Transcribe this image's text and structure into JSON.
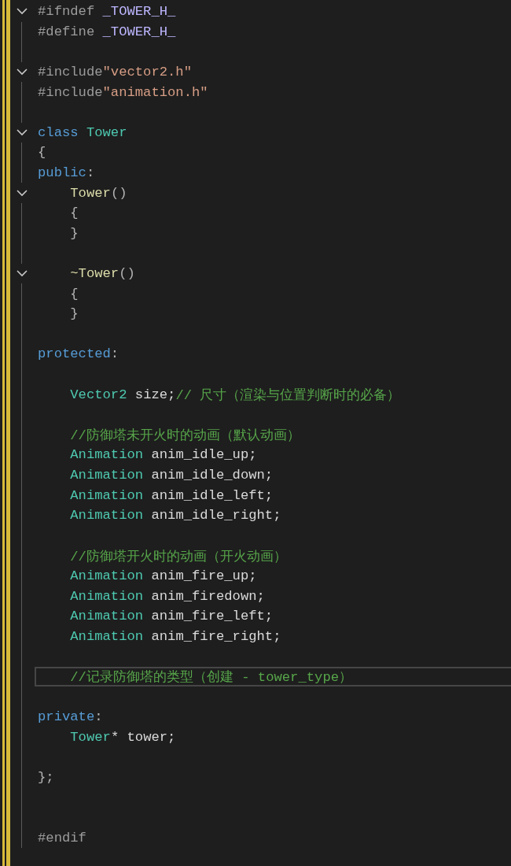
{
  "editor": {
    "lines": [
      {
        "foldable": true,
        "current": false,
        "indented": false,
        "tokens": [
          {
            "kind": "pre",
            "text": "#ifndef"
          },
          {
            "kind": "macro",
            "text": " _TOWER_H_"
          }
        ]
      },
      {
        "foldable": false,
        "current": false,
        "indented": false,
        "tokens": [
          {
            "kind": "pre",
            "text": "#define"
          },
          {
            "kind": "macro",
            "text": " _TOWER_H_"
          }
        ]
      },
      {
        "foldable": false,
        "current": false,
        "indented": false
      },
      {
        "foldable": true,
        "current": false,
        "indented": false,
        "tokens": [
          {
            "kind": "pre",
            "text": "#include"
          },
          {
            "kind": "string",
            "text": "\"vector2.h\""
          }
        ]
      },
      {
        "foldable": false,
        "current": false,
        "indented": false,
        "tokens": [
          {
            "kind": "pre",
            "text": "#include"
          },
          {
            "kind": "string",
            "text": "\"animation.h\""
          }
        ]
      },
      {
        "foldable": false,
        "current": false,
        "indented": false
      },
      {
        "foldable": true,
        "current": false,
        "indented": false,
        "tokens": [
          {
            "kind": "keyword",
            "text": "class"
          },
          {
            "kind": "type",
            "text": " Tower"
          }
        ]
      },
      {
        "foldable": false,
        "current": false,
        "indented": false,
        "tokens": [
          {
            "kind": "punct",
            "text": "{"
          }
        ]
      },
      {
        "foldable": false,
        "current": false,
        "indented": false,
        "tokens": [
          {
            "kind": "keyword",
            "text": "public"
          },
          {
            "kind": "punct",
            "text": ":"
          }
        ]
      },
      {
        "foldable": true,
        "current": false,
        "indented": true,
        "tokens": [
          {
            "kind": "func",
            "text": "Tower"
          },
          {
            "kind": "punct",
            "text": "()"
          }
        ]
      },
      {
        "foldable": false,
        "current": false,
        "indented": true,
        "tokens": [
          {
            "kind": "punct",
            "text": "{"
          }
        ]
      },
      {
        "foldable": false,
        "current": false,
        "indented": true,
        "tokens": [
          {
            "kind": "punct",
            "text": "}"
          }
        ]
      },
      {
        "foldable": false,
        "current": false,
        "indented": false
      },
      {
        "foldable": true,
        "current": false,
        "indented": true,
        "tokens": [
          {
            "kind": "func",
            "text": "~Tower"
          },
          {
            "kind": "punct",
            "text": "()"
          }
        ]
      },
      {
        "foldable": false,
        "current": false,
        "indented": true,
        "tokens": [
          {
            "kind": "punct",
            "text": "{"
          }
        ]
      },
      {
        "foldable": false,
        "current": false,
        "indented": true,
        "tokens": [
          {
            "kind": "punct",
            "text": "}"
          }
        ]
      },
      {
        "foldable": false,
        "current": false,
        "indented": false
      },
      {
        "foldable": false,
        "current": false,
        "indented": false,
        "tokens": [
          {
            "kind": "keyword",
            "text": "protected"
          },
          {
            "kind": "punct",
            "text": ":"
          }
        ]
      },
      {
        "foldable": false,
        "current": false,
        "indented": false
      },
      {
        "foldable": false,
        "current": false,
        "indented": true,
        "tokens": [
          {
            "kind": "type",
            "text": "Vector2"
          },
          {
            "kind": "ident",
            "text": " size;"
          },
          {
            "kind": "comment",
            "text": "// 尺寸（渲染与位置判断时的必备）"
          }
        ]
      },
      {
        "foldable": false,
        "current": false,
        "indented": false
      },
      {
        "foldable": false,
        "current": false,
        "indented": true,
        "tokens": [
          {
            "kind": "comment",
            "text": "//防御塔未开火时的动画（默认动画）"
          }
        ]
      },
      {
        "foldable": false,
        "current": false,
        "indented": true,
        "tokens": [
          {
            "kind": "type",
            "text": "Animation"
          },
          {
            "kind": "ident",
            "text": " anim_idle_up;"
          }
        ]
      },
      {
        "foldable": false,
        "current": false,
        "indented": true,
        "tokens": [
          {
            "kind": "type",
            "text": "Animation"
          },
          {
            "kind": "ident",
            "text": " anim_idle_down;"
          }
        ]
      },
      {
        "foldable": false,
        "current": false,
        "indented": true,
        "tokens": [
          {
            "kind": "type",
            "text": "Animation"
          },
          {
            "kind": "ident",
            "text": " anim_idle_left;"
          }
        ]
      },
      {
        "foldable": false,
        "current": false,
        "indented": true,
        "tokens": [
          {
            "kind": "type",
            "text": "Animation"
          },
          {
            "kind": "ident",
            "text": " anim_idle_right;"
          }
        ]
      },
      {
        "foldable": false,
        "current": false,
        "indented": false
      },
      {
        "foldable": false,
        "current": false,
        "indented": true,
        "tokens": [
          {
            "kind": "comment",
            "text": "//防御塔开火时的动画（开火动画）"
          }
        ]
      },
      {
        "foldable": false,
        "current": false,
        "indented": true,
        "tokens": [
          {
            "kind": "type",
            "text": "Animation"
          },
          {
            "kind": "ident",
            "text": " anim_fire_up;"
          }
        ]
      },
      {
        "foldable": false,
        "current": false,
        "indented": true,
        "tokens": [
          {
            "kind": "type",
            "text": "Animation"
          },
          {
            "kind": "ident",
            "text": " anim_firedown;"
          }
        ]
      },
      {
        "foldable": false,
        "current": false,
        "indented": true,
        "tokens": [
          {
            "kind": "type",
            "text": "Animation"
          },
          {
            "kind": "ident",
            "text": " anim_fire_left;"
          }
        ]
      },
      {
        "foldable": false,
        "current": false,
        "indented": true,
        "tokens": [
          {
            "kind": "type",
            "text": "Animation"
          },
          {
            "kind": "ident",
            "text": " anim_fire_right;"
          }
        ]
      },
      {
        "foldable": false,
        "current": false,
        "indented": false
      },
      {
        "foldable": false,
        "current": true,
        "indented": true,
        "tokens": [
          {
            "kind": "comment",
            "text": "//记录防御塔的类型（创建 - tower_type）"
          }
        ]
      },
      {
        "foldable": false,
        "current": false,
        "indented": false
      },
      {
        "foldable": false,
        "current": false,
        "indented": false,
        "tokens": [
          {
            "kind": "keyword",
            "text": "private"
          },
          {
            "kind": "punct",
            "text": ":"
          }
        ]
      },
      {
        "foldable": false,
        "current": false,
        "indented": true,
        "tokens": [
          {
            "kind": "type",
            "text": "Tower"
          },
          {
            "kind": "ident",
            "text": "* tower;"
          }
        ]
      },
      {
        "foldable": false,
        "current": false,
        "indented": false
      },
      {
        "foldable": false,
        "current": false,
        "indented": false,
        "tokens": [
          {
            "kind": "punct",
            "text": "};"
          }
        ]
      },
      {
        "foldable": false,
        "current": false,
        "indented": false
      },
      {
        "foldable": false,
        "current": false,
        "indented": false
      },
      {
        "foldable": false,
        "current": false,
        "indented": false,
        "tokens": [
          {
            "kind": "pre",
            "text": "#endif"
          }
        ]
      }
    ]
  }
}
